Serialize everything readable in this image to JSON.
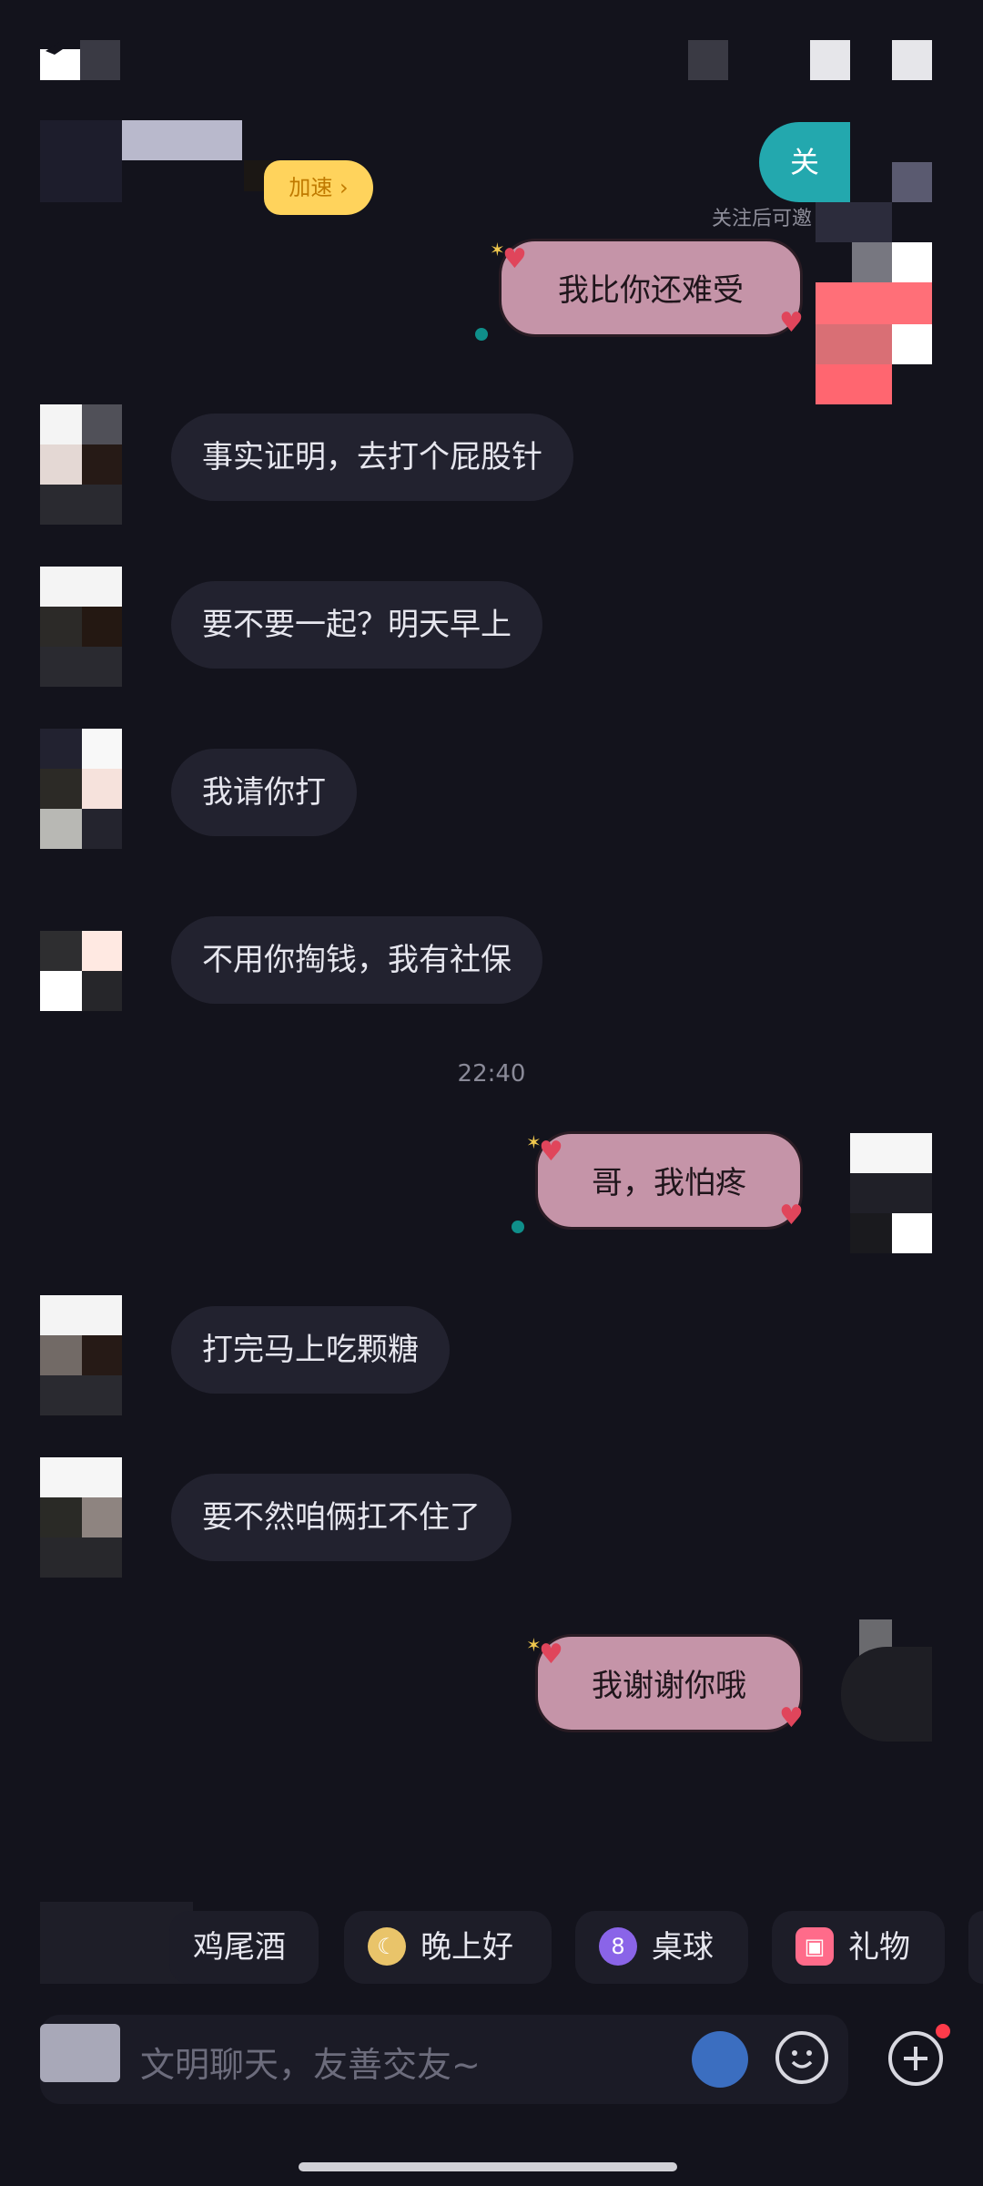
{
  "header": {
    "follow_label": "关",
    "follow_hint": "关注后可邀",
    "badge_label": "加速",
    "brand_partial": "..."
  },
  "messages": [
    {
      "side": "out",
      "text": "我比你还难受"
    },
    {
      "side": "in",
      "text": "事实证明，去打个屁股针"
    },
    {
      "side": "in",
      "text": "要不要一起？明天早上"
    },
    {
      "side": "in",
      "text": "我请你打"
    },
    {
      "side": "in",
      "text": "不用你掏钱，我有社保"
    },
    {
      "side": "time",
      "text": "22:40"
    },
    {
      "side": "out",
      "text": "哥，我怕疼"
    },
    {
      "side": "in",
      "text": "打完马上吃颗糖"
    },
    {
      "side": "in",
      "text": "要不然咱俩扛不住了"
    },
    {
      "side": "out",
      "text": "我谢谢你哦"
    }
  ],
  "chips": [
    {
      "label": "鸡尾酒",
      "icon": "cocktail-icon"
    },
    {
      "label": "晚上好",
      "icon": "moon-icon"
    },
    {
      "label": "桌球",
      "icon": "billiard-ball-icon"
    },
    {
      "label": "礼物",
      "icon": "gift-icon"
    }
  ],
  "input": {
    "placeholder": "文明聊天，友善交友~"
  },
  "colors": {
    "background": "#13131c",
    "bubble_in": "#22222f",
    "bubble_out": "#c594a8",
    "accent": "#23a8ae",
    "badge": "#ffd35c"
  }
}
